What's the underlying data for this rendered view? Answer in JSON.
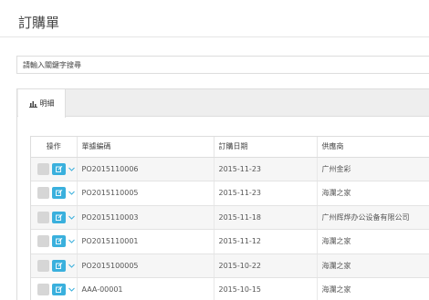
{
  "header": {
    "title": "訂購單"
  },
  "search": {
    "placeholder": "請輸入關鍵字搜尋"
  },
  "tabs": [
    {
      "label": "明細",
      "icon": "bar-chart-icon"
    }
  ],
  "table": {
    "columns": [
      "操作",
      "單據編碼",
      "訂購日期",
      "供應商"
    ],
    "rows": [
      {
        "code": "PO2015110006",
        "date": "2015-11-23",
        "supplier": "广州金彩"
      },
      {
        "code": "PO2015110005",
        "date": "2015-11-23",
        "supplier": "海瀾之家"
      },
      {
        "code": "PO2015110003",
        "date": "2015-11-18",
        "supplier": "广州辉烨办公设备有限公司"
      },
      {
        "code": "PO2015110001",
        "date": "2015-11-12",
        "supplier": "海瀾之家"
      },
      {
        "code": "PO2015100005",
        "date": "2015-10-22",
        "supplier": "海瀾之家"
      },
      {
        "code": "AAA-00001",
        "date": "2015-10-15",
        "supplier": "海瀾之家"
      }
    ]
  },
  "colors": {
    "accent": "#3ab0dd",
    "stripe": "#f6f6f6"
  }
}
